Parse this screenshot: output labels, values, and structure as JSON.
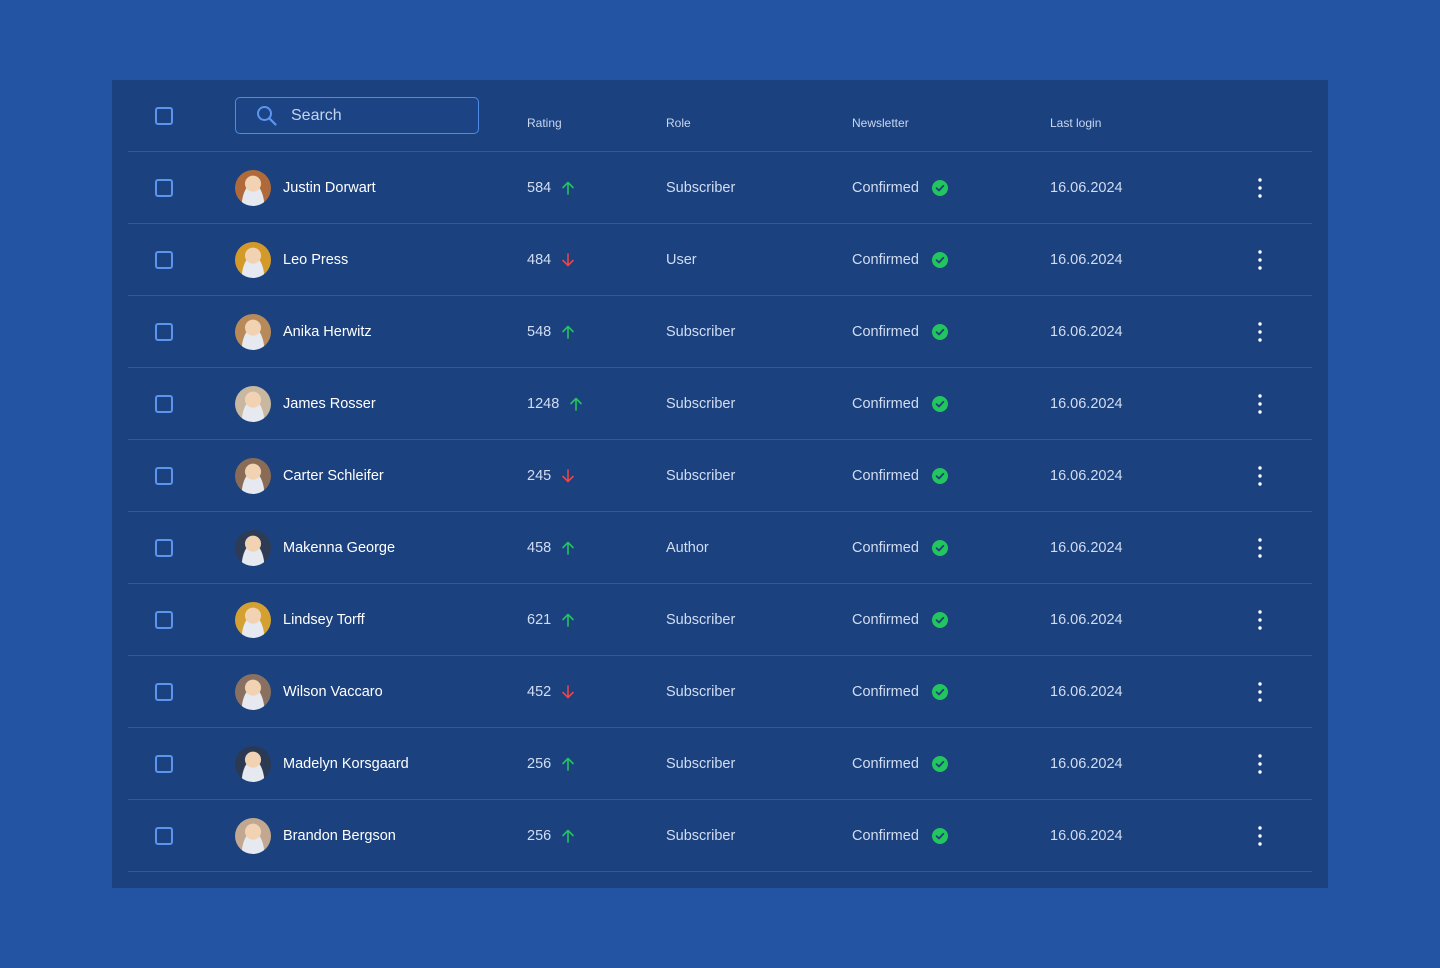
{
  "header": {
    "search_placeholder": "Search",
    "columns": {
      "rating": "Rating",
      "role": "Role",
      "newsletter": "Newsletter",
      "last_login": "Last login"
    }
  },
  "colors": {
    "background": "#2353a3",
    "panel": "#1b417f",
    "up_arrow": "#22c55e",
    "down_arrow": "#ef4444",
    "confirmed_badge": "#22c55e",
    "checkbox_border": "#5b95f0"
  },
  "users": [
    {
      "name": "Justin Dorwart",
      "rating": "584",
      "trend": "up",
      "role": "Subscriber",
      "newsletter": "Confirmed",
      "last_login": "16.06.2024",
      "avatar_color": "#b06a3a"
    },
    {
      "name": "Leo Press",
      "rating": "484",
      "trend": "down",
      "role": "User",
      "newsletter": "Confirmed",
      "last_login": "16.06.2024",
      "avatar_color": "#d39a2a"
    },
    {
      "name": "Anika Herwitz",
      "rating": "548",
      "trend": "up",
      "role": "Subscriber",
      "newsletter": "Confirmed",
      "last_login": "16.06.2024",
      "avatar_color": "#b88a5a"
    },
    {
      "name": "James Rosser",
      "rating": "1248",
      "trend": "up",
      "role": "Subscriber",
      "newsletter": "Confirmed",
      "last_login": "16.06.2024",
      "avatar_color": "#c9b8a0"
    },
    {
      "name": "Carter Schleifer",
      "rating": "245",
      "trend": "down",
      "role": "Subscriber",
      "newsletter": "Confirmed",
      "last_login": "16.06.2024",
      "avatar_color": "#8a6b55"
    },
    {
      "name": "Makenna George",
      "rating": "458",
      "trend": "up",
      "role": "Author",
      "newsletter": "Confirmed",
      "last_login": "16.06.2024",
      "avatar_color": "#2e3b55"
    },
    {
      "name": "Lindsey Torff",
      "rating": "621",
      "trend": "up",
      "role": "Subscriber",
      "newsletter": "Confirmed",
      "last_login": "16.06.2024",
      "avatar_color": "#d4a032"
    },
    {
      "name": "Wilson Vaccaro",
      "rating": "452",
      "trend": "down",
      "role": "Subscriber",
      "newsletter": "Confirmed",
      "last_login": "16.06.2024",
      "avatar_color": "#8a7060"
    },
    {
      "name": "Madelyn Korsgaard",
      "rating": "256",
      "trend": "up",
      "role": "Subscriber",
      "newsletter": "Confirmed",
      "last_login": "16.06.2024",
      "avatar_color": "#2b3a52"
    },
    {
      "name": "Brandon Bergson",
      "rating": "256",
      "trend": "up",
      "role": "Subscriber",
      "newsletter": "Confirmed",
      "last_login": "16.06.2024",
      "avatar_color": "#c2a890"
    }
  ]
}
